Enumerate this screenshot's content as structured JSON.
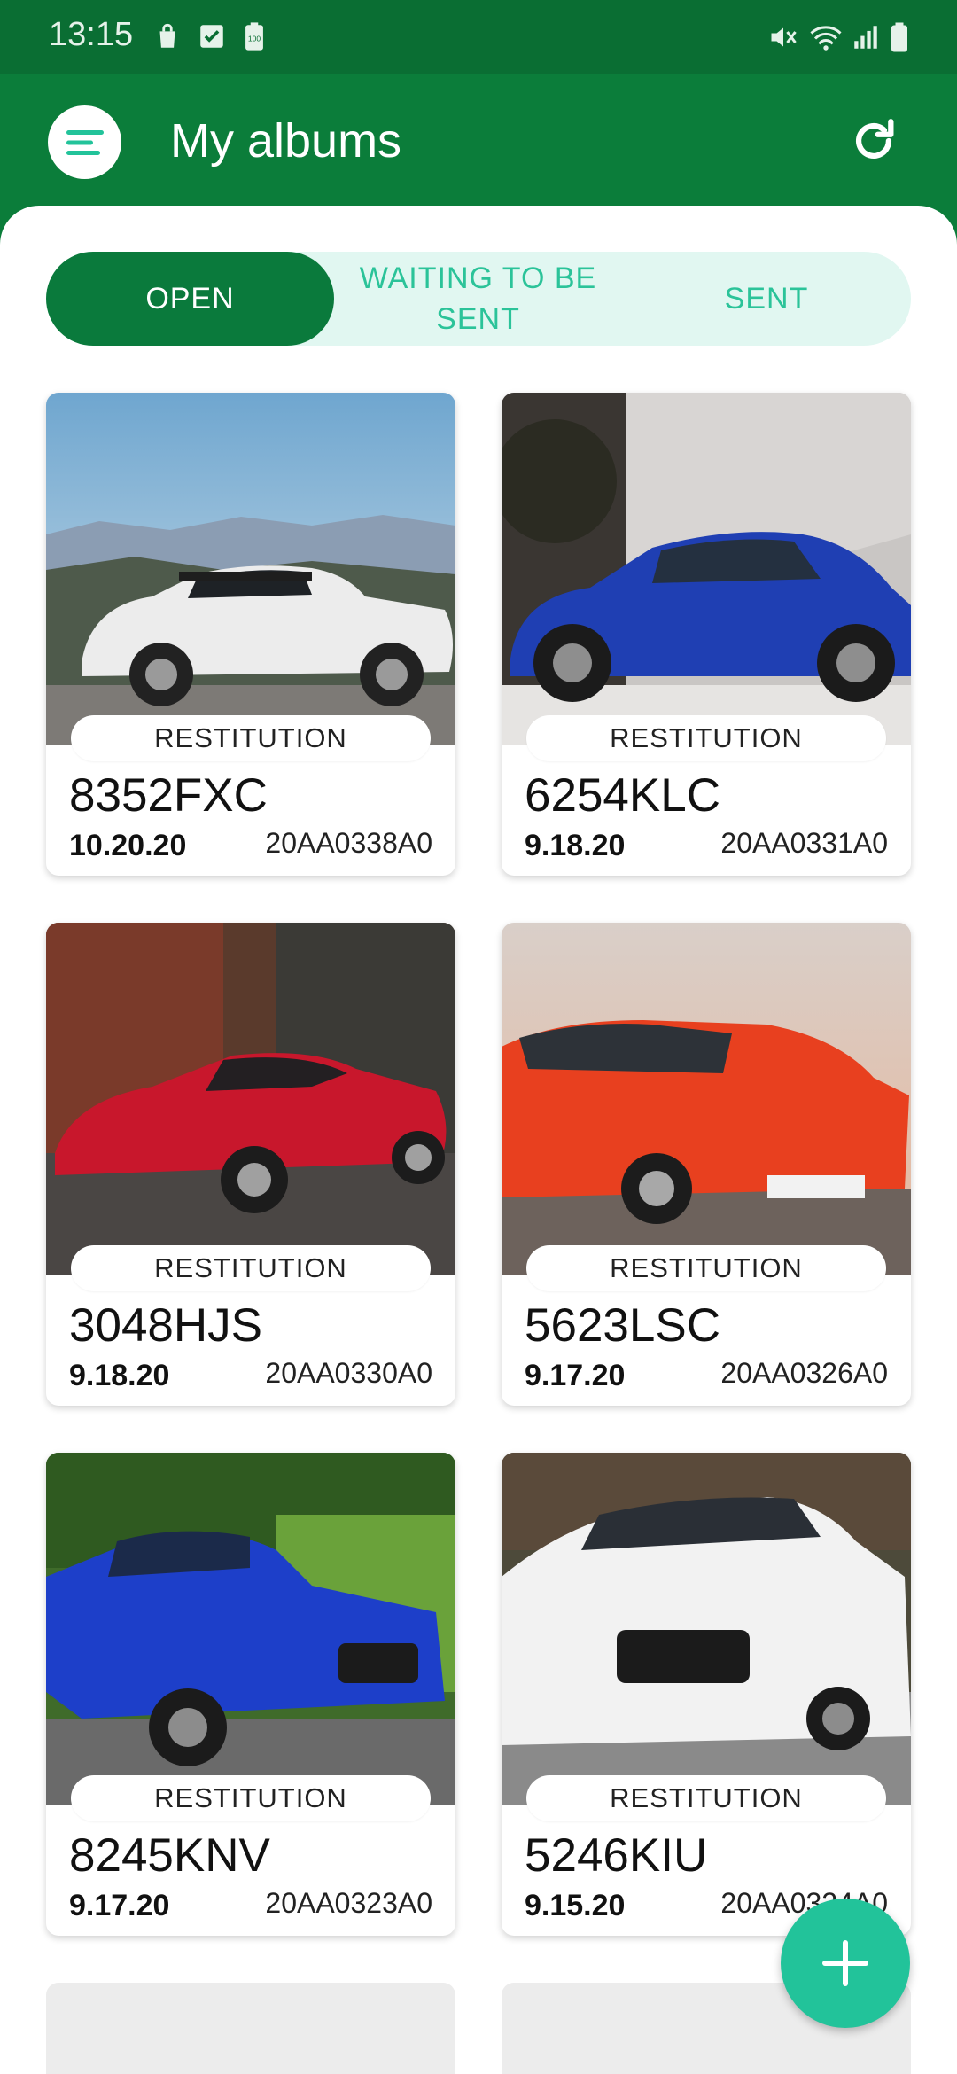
{
  "status_bar": {
    "time": "13:15",
    "left_icons": [
      "shopping-bag-icon",
      "checkbox-icon",
      "battery-saver-icon"
    ],
    "right_icons": [
      "mute-icon",
      "wifi-icon",
      "signal-icon",
      "battery-icon"
    ]
  },
  "app_bar": {
    "title": "My albums",
    "menu_icon": "menu-icon",
    "refresh_icon": "refresh-icon"
  },
  "tabs": [
    {
      "label": "OPEN",
      "active": true
    },
    {
      "label": "WAITING TO BE SENT",
      "active": false
    },
    {
      "label": "SENT",
      "active": false
    }
  ],
  "albums": [
    {
      "badge": "RESTITUTION",
      "plate": "8352FXC",
      "date": "10.20.20",
      "code": "20AA0338A0",
      "car_color": "#e8e8e8"
    },
    {
      "badge": "RESTITUTION",
      "plate": "6254KLC",
      "date": "9.18.20",
      "code": "20AA0331A0",
      "car_color": "#1f3fb3"
    },
    {
      "badge": "RESTITUTION",
      "plate": "3048HJS",
      "date": "9.18.20",
      "code": "20AA0330A0",
      "car_color": "#c8172c"
    },
    {
      "badge": "RESTITUTION",
      "plate": "5623LSC",
      "date": "9.17.20",
      "code": "20AA0326A0",
      "car_color": "#e8401f"
    },
    {
      "badge": "RESTITUTION",
      "plate": "8245KNV",
      "date": "9.17.20",
      "code": "20AA0323A0",
      "car_color": "#1d3fc9"
    },
    {
      "badge": "RESTITUTION",
      "plate": "5246KIU",
      "date": "9.15.20",
      "code": "20AA0324A0",
      "car_color": "#f2f2f2"
    }
  ],
  "fab_icon": "plus-icon",
  "colors": {
    "primary": "#0b7d3a",
    "status_bar": "#0a6e33",
    "accent": "#22c39a",
    "tab_background": "#e1f7f1"
  }
}
